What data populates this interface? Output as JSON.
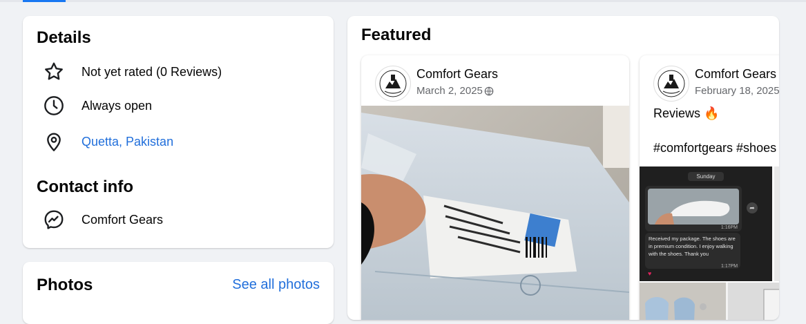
{
  "details": {
    "title": "Details",
    "rating": "Not yet rated (0 Reviews)",
    "hours": "Always open",
    "location": "Quetta, Pakistan"
  },
  "contact": {
    "title": "Contact info",
    "messenger": "Comfort Gears"
  },
  "photos": {
    "title": "Photos",
    "see_all": "See all photos"
  },
  "featured": {
    "title": "Featured",
    "posts": [
      {
        "author": "Comfort Gears",
        "date": "March 2, 2025"
      },
      {
        "author": "Comfort Gears",
        "date": "February 18, 2025",
        "text_line1": "Reviews 🔥",
        "text_line2": "#comfortgears #shoes",
        "chat": {
          "day": "Sunday",
          "time1": "1:16PM",
          "message": "Received my package. The shoes are in premium condition. I enjoy walking with the shoes. Thank you",
          "time2": "1:17PM"
        }
      }
    ]
  },
  "colors": {
    "link": "#216fdb",
    "accent": "#1877f2",
    "background": "#f0f2f5"
  }
}
